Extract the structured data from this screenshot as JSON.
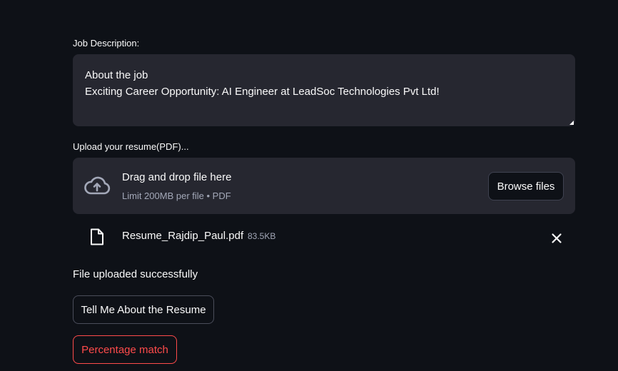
{
  "job_description": {
    "label": "Job Description:",
    "lines": [
      "About the job",
      "Exciting Career Opportunity: AI Engineer at LeadSoc Technologies Pvt Ltd!"
    ]
  },
  "uploader": {
    "label": "Upload your resume(PDF)...",
    "drop_title": "Drag and drop file here",
    "drop_subtitle": "Limit 200MB per file • PDF",
    "browse_label": "Browse files",
    "cloud_icon": "cloud-upload-icon"
  },
  "uploaded_file": {
    "name": "Resume_Rajdip_Paul.pdf",
    "size": "83.5KB",
    "file_icon": "file-icon",
    "remove_icon": "close-icon"
  },
  "status": {
    "message": "File uploaded successfully"
  },
  "actions": {
    "tell_label": "Tell Me About the Resume",
    "percentage_label": "Percentage match"
  },
  "colors": {
    "background": "#0e1117",
    "surface": "#262730",
    "text": "#fafafa",
    "muted": "#a3a8b8",
    "accent": "#ff4b4b"
  }
}
